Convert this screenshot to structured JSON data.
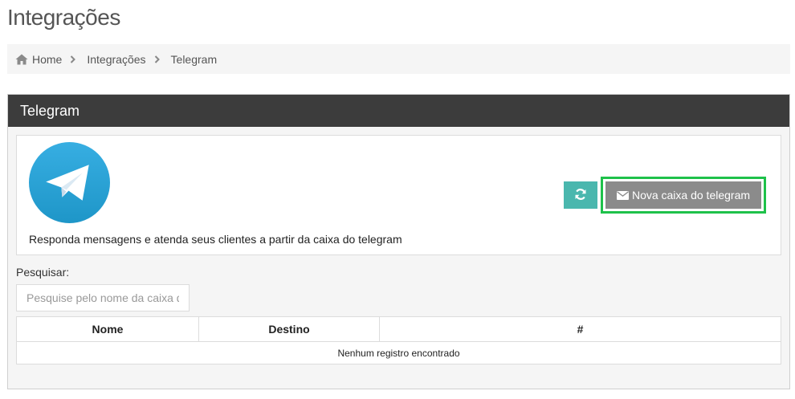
{
  "page": {
    "title": "Integrações"
  },
  "breadcrumb": {
    "items": [
      {
        "label": "Home",
        "icon": "home-icon"
      },
      {
        "label": "Integrações"
      },
      {
        "label": "Telegram"
      }
    ]
  },
  "panel": {
    "title": "Telegram",
    "description": "Responda mensagens e atenda seus clientes a partir da caixa do telegram",
    "logo_icon": "telegram-logo",
    "accent_colors": {
      "header_bg": "#3c3c3c",
      "refresh_button": "#4ab7ae",
      "new_box_button": "#8b8b8b",
      "highlight": "#1ec14a",
      "telegram_blue": "#2aa3df"
    }
  },
  "toolbar": {
    "refresh_icon": "refresh-icon",
    "new_box_label": "Nova caixa do telegram",
    "new_box_icon": "envelope-icon"
  },
  "search": {
    "label": "Pesquisar:",
    "placeholder": "Pesquise pelo nome da caixa de entrada",
    "value": ""
  },
  "table": {
    "columns": [
      "Nome",
      "Destino",
      "#"
    ],
    "empty_message": "Nenhum registro encontrado"
  }
}
